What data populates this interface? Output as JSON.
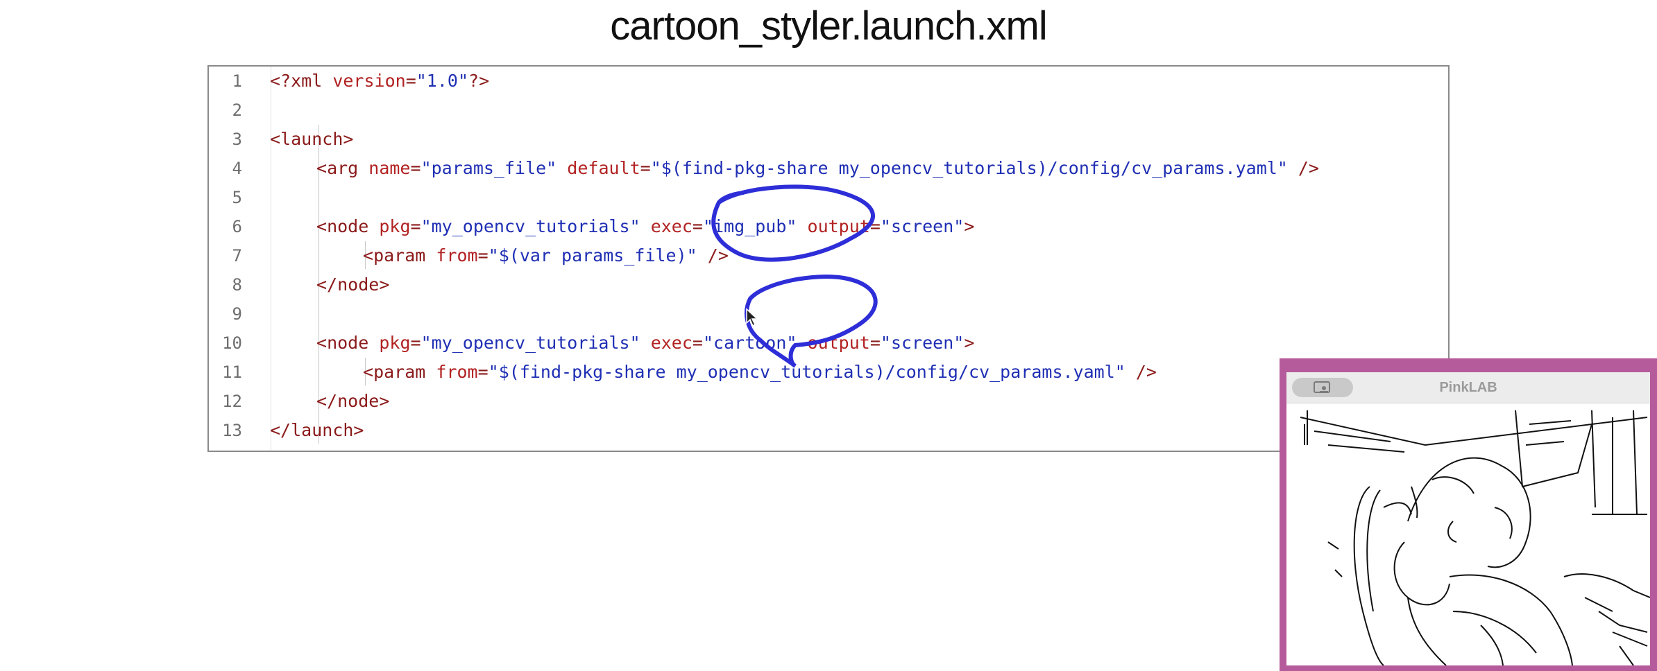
{
  "slide": {
    "title": "cartoon_styler.launch.xml"
  },
  "code": {
    "lines": [
      {
        "num": "1",
        "text": "<?xml version=\"1.0\"?>"
      },
      {
        "num": "2",
        "text": ""
      },
      {
        "num": "3",
        "text": "<launch>"
      },
      {
        "num": "4",
        "text": "<arg name=\"params_file\" default=\"$(find-pkg-share my_opencv_tutorials)/config/cv_params.yaml\" />"
      },
      {
        "num": "5",
        "text": ""
      },
      {
        "num": "6",
        "text": "<node pkg=\"my_opencv_tutorials\" exec=\"img_pub\" output=\"screen\">"
      },
      {
        "num": "7",
        "text": "<param from=\"$(var params_file)\" />"
      },
      {
        "num": "8",
        "text": "</node>"
      },
      {
        "num": "9",
        "text": ""
      },
      {
        "num": "10",
        "text": "<node pkg=\"my_opencv_tutorials\" exec=\"cartoon\" output=\"screen\">"
      },
      {
        "num": "11",
        "text": "<param from=\"$(find-pkg-share my_opencv_tutorials)/config/cv_params.yaml\" />"
      },
      {
        "num": "12",
        "text": "</node>"
      },
      {
        "num": "13",
        "text": "</launch>"
      }
    ]
  },
  "pip_window": {
    "title": "PinkLAB",
    "badge_icon": "screen-share-icon",
    "border_color": "#b55b9c"
  },
  "annotation": {
    "ink_color": "#2e2ed8"
  }
}
